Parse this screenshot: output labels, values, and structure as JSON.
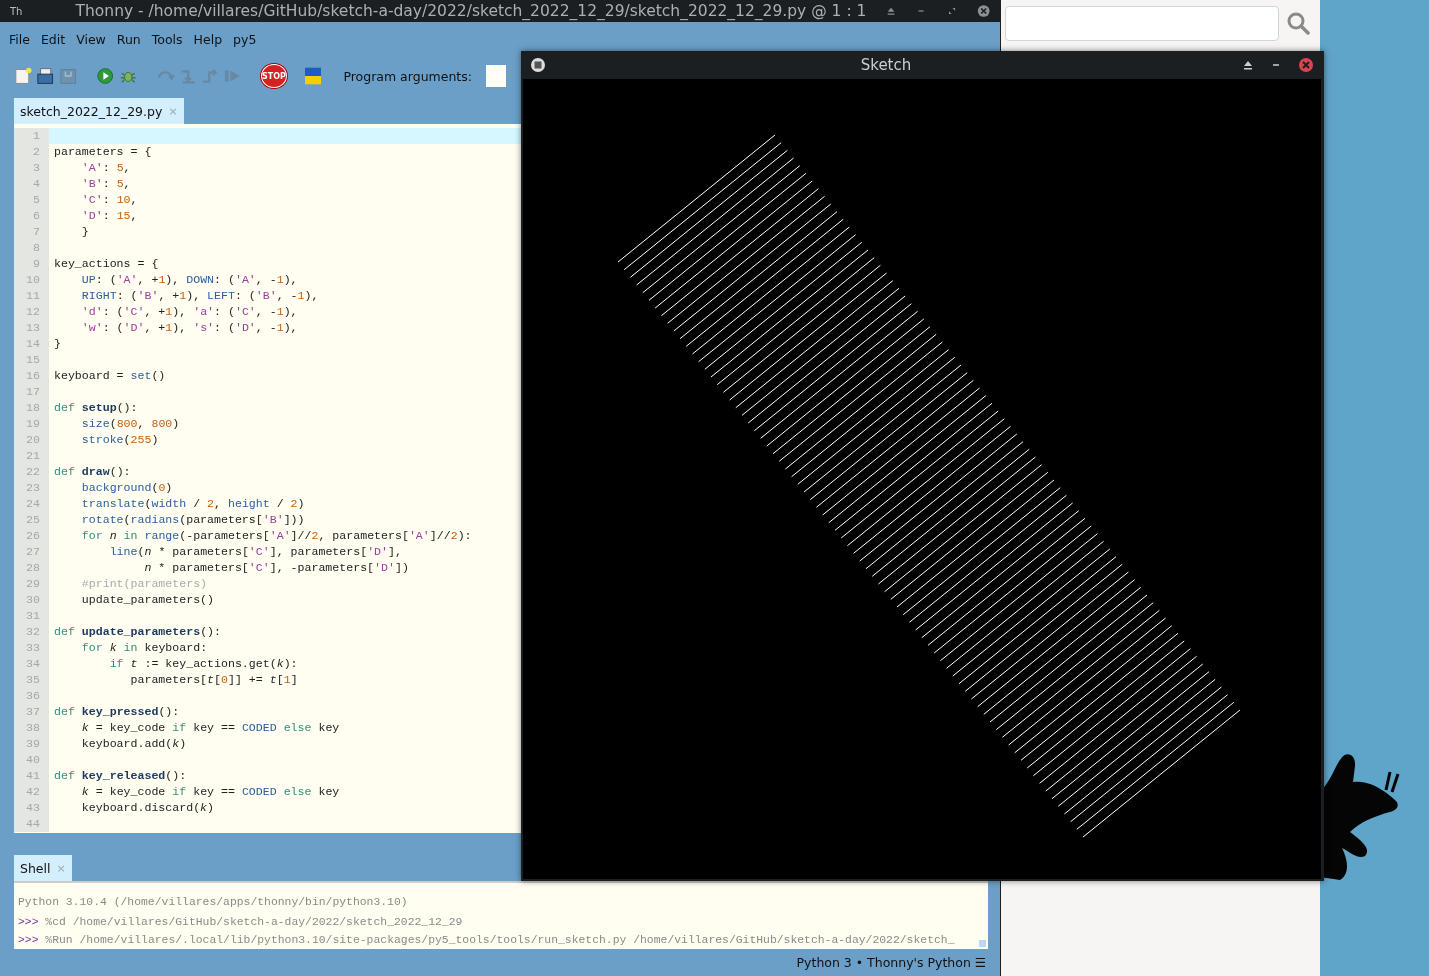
{
  "thonny": {
    "app_icon": "Th",
    "title": "Thonny  -  /home/villares/GitHub/sketch-a-day/2022/sketch_2022_12_29/sketch_2022_12_29.py  @  1 : 1",
    "menu": [
      "File",
      "Edit",
      "View",
      "Run",
      "Tools",
      "Help",
      "py5"
    ],
    "toolbar": [
      {
        "kind": "new",
        "disabled": false
      },
      {
        "kind": "open",
        "disabled": false
      },
      {
        "kind": "save",
        "disabled": true
      },
      {
        "kind": "run",
        "disabled": false
      },
      {
        "kind": "debug",
        "disabled": false
      },
      {
        "kind": "stepover",
        "disabled": true
      },
      {
        "kind": "stepinto",
        "disabled": true
      },
      {
        "kind": "stepout",
        "disabled": true
      },
      {
        "kind": "resume",
        "disabled": true
      },
      {
        "kind": "stop",
        "disabled": false
      },
      {
        "kind": "flag",
        "disabled": false
      }
    ],
    "stop_label": "STOP",
    "program_arguments_label": "Program arguments:",
    "editor_tabs": [
      {
        "label": "sketch_2022_12_29.py",
        "close": "×",
        "selected": true
      }
    ],
    "code": [
      {
        "no": "1",
        "current": true
      },
      {
        "no": "2",
        "current": false,
        "tokens": [
          {
            "kind": "plain",
            "text": "parameters = {"
          }
        ]
      },
      {
        "no": "3",
        "current": false,
        "tokens": [
          {
            "kind": "string",
            "text": "    'A'"
          },
          {
            "kind": "plain",
            "text": ": "
          },
          {
            "kind": "number",
            "text": "5"
          },
          {
            "kind": "plain",
            "text": ","
          }
        ]
      },
      {
        "no": "4",
        "current": false,
        "tokens": [
          {
            "kind": "string",
            "text": "    'B'"
          },
          {
            "kind": "plain",
            "text": ": "
          },
          {
            "kind": "number",
            "text": "5"
          },
          {
            "kind": "plain",
            "text": ","
          }
        ]
      },
      {
        "no": "5",
        "current": false,
        "tokens": [
          {
            "kind": "string",
            "text": "    'C'"
          },
          {
            "kind": "plain",
            "text": ": "
          },
          {
            "kind": "number",
            "text": "10"
          },
          {
            "kind": "plain",
            "text": ","
          }
        ]
      },
      {
        "no": "6",
        "current": false,
        "tokens": [
          {
            "kind": "string",
            "text": "    'D'"
          },
          {
            "kind": "plain",
            "text": ": "
          },
          {
            "kind": "number",
            "text": "15"
          },
          {
            "kind": "plain",
            "text": ","
          }
        ]
      },
      {
        "no": "7",
        "current": false,
        "tokens": [
          {
            "kind": "plain",
            "text": "    }"
          }
        ]
      },
      {
        "no": "8",
        "current": false
      },
      {
        "no": "9",
        "current": false,
        "tokens": [
          {
            "kind": "plain",
            "text": "key_actions = {"
          }
        ]
      },
      {
        "no": "10",
        "current": false,
        "tokens": [
          {
            "kind": "builtin",
            "text": "    UP"
          },
          {
            "kind": "plain",
            "text": ": ("
          },
          {
            "kind": "string",
            "text": "'A'"
          },
          {
            "kind": "plain",
            "text": ", +"
          },
          {
            "kind": "number",
            "text": "1"
          },
          {
            "kind": "plain",
            "text": "), "
          },
          {
            "kind": "builtin",
            "text": "DOWN"
          },
          {
            "kind": "plain",
            "text": ": ("
          },
          {
            "kind": "string",
            "text": "'A'"
          },
          {
            "kind": "plain",
            "text": ", -"
          },
          {
            "kind": "number",
            "text": "1"
          },
          {
            "kind": "plain",
            "text": "),"
          }
        ]
      },
      {
        "no": "11",
        "current": false,
        "tokens": [
          {
            "kind": "builtin",
            "text": "    RIGHT"
          },
          {
            "kind": "plain",
            "text": ": ("
          },
          {
            "kind": "string",
            "text": "'B'"
          },
          {
            "kind": "plain",
            "text": ", +"
          },
          {
            "kind": "number",
            "text": "1"
          },
          {
            "kind": "plain",
            "text": "), "
          },
          {
            "kind": "builtin",
            "text": "LEFT"
          },
          {
            "kind": "plain",
            "text": ": ("
          },
          {
            "kind": "string",
            "text": "'B'"
          },
          {
            "kind": "plain",
            "text": ", -"
          },
          {
            "kind": "number",
            "text": "1"
          },
          {
            "kind": "plain",
            "text": "),"
          }
        ]
      },
      {
        "no": "12",
        "current": false,
        "tokens": [
          {
            "kind": "string",
            "text": "    'd'"
          },
          {
            "kind": "plain",
            "text": ": ("
          },
          {
            "kind": "string",
            "text": "'C'"
          },
          {
            "kind": "plain",
            "text": ", +"
          },
          {
            "kind": "number",
            "text": "1"
          },
          {
            "kind": "plain",
            "text": "), "
          },
          {
            "kind": "string",
            "text": "'a'"
          },
          {
            "kind": "plain",
            "text": ": ("
          },
          {
            "kind": "string",
            "text": "'C'"
          },
          {
            "kind": "plain",
            "text": ", -"
          },
          {
            "kind": "number",
            "text": "1"
          },
          {
            "kind": "plain",
            "text": "),"
          }
        ]
      },
      {
        "no": "13",
        "current": false,
        "tokens": [
          {
            "kind": "string",
            "text": "    'w'"
          },
          {
            "kind": "plain",
            "text": ": ("
          },
          {
            "kind": "string",
            "text": "'D'"
          },
          {
            "kind": "plain",
            "text": ", +"
          },
          {
            "kind": "number",
            "text": "1"
          },
          {
            "kind": "plain",
            "text": "), "
          },
          {
            "kind": "string",
            "text": "'s'"
          },
          {
            "kind": "plain",
            "text": ": ("
          },
          {
            "kind": "string",
            "text": "'D'"
          },
          {
            "kind": "plain",
            "text": ", -"
          },
          {
            "kind": "number",
            "text": "1"
          },
          {
            "kind": "plain",
            "text": "),"
          }
        ]
      },
      {
        "no": "14",
        "current": false,
        "tokens": [
          {
            "kind": "plain",
            "text": "}"
          }
        ]
      },
      {
        "no": "15",
        "current": false
      },
      {
        "no": "16",
        "current": false,
        "tokens": [
          {
            "kind": "plain",
            "text": "keyboard = "
          },
          {
            "kind": "builtin",
            "text": "set"
          },
          {
            "kind": "plain",
            "text": "()"
          }
        ]
      },
      {
        "no": "17",
        "current": false
      },
      {
        "no": "18",
        "current": false,
        "tokens": [
          {
            "kind": "keyword",
            "text": "def "
          },
          {
            "kind": "definition",
            "text": "setup"
          },
          {
            "kind": "plain",
            "text": "():"
          }
        ]
      },
      {
        "no": "19",
        "current": false,
        "tokens": [
          {
            "kind": "builtin",
            "text": "    size"
          },
          {
            "kind": "plain",
            "text": "("
          },
          {
            "kind": "number",
            "text": "800"
          },
          {
            "kind": "plain",
            "text": ", "
          },
          {
            "kind": "number",
            "text": "800"
          },
          {
            "kind": "plain",
            "text": ")"
          }
        ]
      },
      {
        "no": "20",
        "current": false,
        "tokens": [
          {
            "kind": "builtin",
            "text": "    stroke"
          },
          {
            "kind": "plain",
            "text": "("
          },
          {
            "kind": "number",
            "text": "255"
          },
          {
            "kind": "plain",
            "text": ")"
          }
        ]
      },
      {
        "no": "21",
        "current": false
      },
      {
        "no": "22",
        "current": false,
        "tokens": [
          {
            "kind": "keyword",
            "text": "def "
          },
          {
            "kind": "definition",
            "text": "draw"
          },
          {
            "kind": "plain",
            "text": "():"
          }
        ]
      },
      {
        "no": "23",
        "current": false,
        "tokens": [
          {
            "kind": "builtin",
            "text": "    background"
          },
          {
            "kind": "plain",
            "text": "("
          },
          {
            "kind": "number",
            "text": "0"
          },
          {
            "kind": "plain",
            "text": ")"
          }
        ]
      },
      {
        "no": "24",
        "current": false,
        "tokens": [
          {
            "kind": "builtin",
            "text": "    translate"
          },
          {
            "kind": "plain",
            "text": "("
          },
          {
            "kind": "builtin",
            "text": "width"
          },
          {
            "kind": "plain",
            "text": " / "
          },
          {
            "kind": "number",
            "text": "2"
          },
          {
            "kind": "plain",
            "text": ", "
          },
          {
            "kind": "builtin",
            "text": "height"
          },
          {
            "kind": "plain",
            "text": " / "
          },
          {
            "kind": "number",
            "text": "2"
          },
          {
            "kind": "plain",
            "text": ")"
          }
        ]
      },
      {
        "no": "25",
        "current": false,
        "tokens": [
          {
            "kind": "builtin",
            "text": "    rotate"
          },
          {
            "kind": "plain",
            "text": "("
          },
          {
            "kind": "builtin",
            "text": "radians"
          },
          {
            "kind": "plain",
            "text": "(parameters["
          },
          {
            "kind": "string",
            "text": "'B'"
          },
          {
            "kind": "plain",
            "text": "]))"
          }
        ]
      },
      {
        "no": "26",
        "current": false,
        "tokens": [
          {
            "kind": "keyword",
            "text": "    for "
          },
          {
            "kind": "variable",
            "text": "n"
          },
          {
            "kind": "keyword",
            "text": " in "
          },
          {
            "kind": "builtin",
            "text": "range"
          },
          {
            "kind": "plain",
            "text": "(-parameters["
          },
          {
            "kind": "string",
            "text": "'A'"
          },
          {
            "kind": "plain",
            "text": "]//"
          },
          {
            "kind": "number",
            "text": "2"
          },
          {
            "kind": "plain",
            "text": ", parameters["
          },
          {
            "kind": "string",
            "text": "'A'"
          },
          {
            "kind": "plain",
            "text": "]//"
          },
          {
            "kind": "number",
            "text": "2"
          },
          {
            "kind": "plain",
            "text": "):"
          }
        ]
      },
      {
        "no": "27",
        "current": false,
        "tokens": [
          {
            "kind": "builtin",
            "text": "        line"
          },
          {
            "kind": "plain",
            "text": "("
          },
          {
            "kind": "variable",
            "text": "n"
          },
          {
            "kind": "plain",
            "text": " * parameters["
          },
          {
            "kind": "string",
            "text": "'C'"
          },
          {
            "kind": "plain",
            "text": "], parameters["
          },
          {
            "kind": "string",
            "text": "'D'"
          },
          {
            "kind": "plain",
            "text": "],"
          }
        ]
      },
      {
        "no": "28",
        "current": false,
        "tokens": [
          {
            "kind": "variable",
            "text": "             n"
          },
          {
            "kind": "plain",
            "text": " * parameters["
          },
          {
            "kind": "string",
            "text": "'C'"
          },
          {
            "kind": "plain",
            "text": "], -parameters["
          },
          {
            "kind": "string",
            "text": "'D'"
          },
          {
            "kind": "plain",
            "text": "])"
          }
        ]
      },
      {
        "no": "29",
        "current": false,
        "tokens": [
          {
            "kind": "comment",
            "text": "    #print(parameters)"
          }
        ]
      },
      {
        "no": "30",
        "current": false,
        "tokens": [
          {
            "kind": "plain",
            "text": "    update_parameters()"
          }
        ]
      },
      {
        "no": "31",
        "current": false
      },
      {
        "no": "32",
        "current": false,
        "tokens": [
          {
            "kind": "keyword",
            "text": "def "
          },
          {
            "kind": "definition",
            "text": "update_parameters"
          },
          {
            "kind": "plain",
            "text": "():"
          }
        ]
      },
      {
        "no": "33",
        "current": false,
        "tokens": [
          {
            "kind": "keyword",
            "text": "    for "
          },
          {
            "kind": "variable",
            "text": "k"
          },
          {
            "kind": "keyword",
            "text": " in"
          },
          {
            "kind": "plain",
            "text": " keyboard:"
          }
        ]
      },
      {
        "no": "34",
        "current": false,
        "tokens": [
          {
            "kind": "keyword",
            "text": "        if "
          },
          {
            "kind": "variable",
            "text": "t"
          },
          {
            "kind": "plain",
            "text": " := key_actions.get("
          },
          {
            "kind": "variable",
            "text": "k"
          },
          {
            "kind": "plain",
            "text": "):"
          }
        ]
      },
      {
        "no": "35",
        "current": false,
        "tokens": [
          {
            "kind": "plain",
            "text": "           parameters["
          },
          {
            "kind": "variable",
            "text": "t"
          },
          {
            "kind": "plain",
            "text": "["
          },
          {
            "kind": "number",
            "text": "0"
          },
          {
            "kind": "plain",
            "text": "]] += "
          },
          {
            "kind": "variable",
            "text": "t"
          },
          {
            "kind": "plain",
            "text": "["
          },
          {
            "kind": "number",
            "text": "1"
          },
          {
            "kind": "plain",
            "text": "]"
          }
        ]
      },
      {
        "no": "36",
        "current": false
      },
      {
        "no": "37",
        "current": false,
        "tokens": [
          {
            "kind": "keyword",
            "text": "def "
          },
          {
            "kind": "definition",
            "text": "key_pressed"
          },
          {
            "kind": "plain",
            "text": "():"
          }
        ]
      },
      {
        "no": "38",
        "current": false,
        "tokens": [
          {
            "kind": "variable",
            "text": "    k"
          },
          {
            "kind": "plain",
            "text": " = key_code "
          },
          {
            "kind": "keyword",
            "text": "if"
          },
          {
            "kind": "plain",
            "text": " key == "
          },
          {
            "kind": "builtin",
            "text": "CODED"
          },
          {
            "kind": "keyword",
            "text": " else"
          },
          {
            "kind": "plain",
            "text": " key"
          }
        ]
      },
      {
        "no": "39",
        "current": false,
        "tokens": [
          {
            "kind": "plain",
            "text": "    keyboard.add("
          },
          {
            "kind": "variable",
            "text": "k"
          },
          {
            "kind": "plain",
            "text": ")"
          }
        ]
      },
      {
        "no": "40",
        "current": false
      },
      {
        "no": "41",
        "current": false,
        "tokens": [
          {
            "kind": "keyword",
            "text": "def "
          },
          {
            "kind": "definition",
            "text": "key_released"
          },
          {
            "kind": "plain",
            "text": "():"
          }
        ]
      },
      {
        "no": "42",
        "current": false,
        "tokens": [
          {
            "kind": "variable",
            "text": "    k"
          },
          {
            "kind": "plain",
            "text": " = key_code "
          },
          {
            "kind": "keyword",
            "text": "if"
          },
          {
            "kind": "plain",
            "text": " key == "
          },
          {
            "kind": "builtin",
            "text": "CODED"
          },
          {
            "kind": "keyword",
            "text": " else"
          },
          {
            "kind": "plain",
            "text": " key"
          }
        ]
      },
      {
        "no": "43",
        "current": false,
        "tokens": [
          {
            "kind": "plain",
            "text": "    keyboard.discard("
          },
          {
            "kind": "variable",
            "text": "k"
          },
          {
            "kind": "plain",
            "text": ")"
          }
        ]
      },
      {
        "no": "44",
        "current": false
      }
    ],
    "shell_tab": {
      "label": "Shell",
      "close": "×",
      "selected": true
    },
    "shell": [
      {
        "kind": "info",
        "text": "Python 3.10.4 (/home/villares/apps/thonny/bin/python3.10)"
      },
      {
        "kind": "command",
        "prompt": ">>>",
        "text": "%cd /home/villares/GitHub/sketch-a-day/2022/sketch_2022_12_29"
      },
      {
        "kind": "command",
        "prompt": ">>>",
        "text": "%Run /home/villares/.local/lib/python3.10/site-packages/py5_tools/tools/run_sketch.py /home/villares/GitHub/sketch-a-day/2022/sketch_"
      }
    ],
    "status": "Python 3 • Thonny's Python ☰"
  },
  "sketch_window": {
    "title": "Sketch"
  }
}
